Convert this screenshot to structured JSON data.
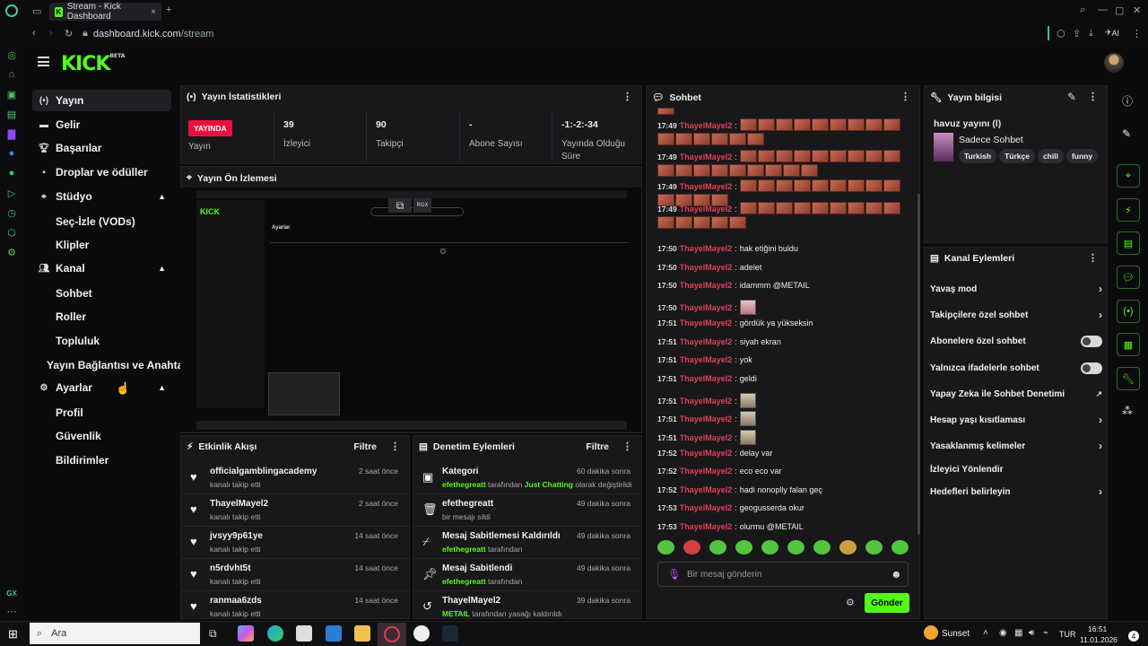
{
  "browser": {
    "tab_title": "Stream - Kick Dashboard",
    "url_host": "dashboard.kick.com",
    "url_path": "/stream",
    "ai_label": "AI"
  },
  "header": {
    "logo": "KICK",
    "beta": "BETA"
  },
  "nav": {
    "yayin": "Yayın",
    "gelir": "Gelir",
    "basarilar": "Başarılar",
    "droplar": "Droplar ve ödüller",
    "studyo": "Stüdyo",
    "sec_izle": "Seç-İzle (VODs)",
    "klipler": "Klipler",
    "kanal": "Kanal",
    "sohbet": "Sohbet",
    "roller": "Roller",
    "topluluk": "Topluluk",
    "yayin_baglantisi": "Yayın Bağlantısı ve Anahtarı",
    "ayarlar": "Ayarlar",
    "profil": "Profil",
    "guvenlik": "Güvenlik",
    "bildirimler": "Bildirimler"
  },
  "stats": {
    "title": "Yayın İstatistikleri",
    "live_badge": "YAYINDA",
    "live_label": "Yayın",
    "viewers": "39",
    "viewers_label": "İzleyici",
    "followers": "90",
    "followers_label": "Takipçi",
    "subs": "-",
    "subs_label": "Abone Sayısı",
    "duration": "-1:-2:-34",
    "duration_label": "Yayında Olduğu Süre"
  },
  "preview": {
    "title": "Yayın Ön İzlemesi",
    "rgx": "RGX",
    "mini_title": "Ayarlar"
  },
  "activity": {
    "title": "Etkinlik Akışı",
    "filter": "Filtre",
    "items": [
      {
        "name": "officialgamblingacademy",
        "sub": "kanalı takip etti",
        "time": "2 saat önce"
      },
      {
        "name": "ThayelMayel2",
        "sub": "kanalı takip etti",
        "time": "2 saat önce"
      },
      {
        "name": "jvsyy9p61ye",
        "sub": "kanalı takip etti",
        "time": "14 saat önce"
      },
      {
        "name": "n5rdvht5t",
        "sub": "kanalı takip etti",
        "time": "14 saat önce"
      },
      {
        "name": "ranmaa6zds",
        "sub": "kanalı takip etti",
        "time": "14 saat önce"
      }
    ]
  },
  "moderation": {
    "title": "Denetim Eylemleri",
    "filter": "Filtre",
    "items": [
      {
        "name": "Kategori",
        "who": "efethegreatt",
        "sub": " tarafından ",
        "extra": "Just Chatting",
        "tail": " olarak değiştirildi",
        "time": "60 dakika sonra"
      },
      {
        "name": "efethegreatt",
        "who": "",
        "sub": "bir mesajı sildi",
        "extra": "",
        "tail": "",
        "time": "49 dakika sonra"
      },
      {
        "name": "Mesaj Sabitlemesi Kaldırıldı",
        "who": "efethegreatt",
        "sub": " tarafından",
        "extra": "",
        "tail": "",
        "time": "49 dakika sonra"
      },
      {
        "name": "Mesaj Sabitlendi",
        "who": "efethegreatt",
        "sub": " tarafından",
        "extra": "",
        "tail": "",
        "time": "49 dakika sonra"
      },
      {
        "name": "ThayelMayel2",
        "who": "METAIL",
        "sub": " tarafından yasağı kaldırıldı",
        "extra": "",
        "tail": "",
        "time": "39 dakika sonra"
      }
    ]
  },
  "chat": {
    "title": "Sohbet",
    "user": "ThayelMayel2",
    "messages": [
      {
        "time": "17:49",
        "text": ""
      },
      {
        "time": "17:49",
        "text": ""
      },
      {
        "time": "17:49",
        "text": ""
      },
      {
        "time": "17:49",
        "text": ""
      },
      {
        "time": "17:50",
        "text": "hak etiğini buldu"
      },
      {
        "time": "17:50",
        "text": "adelet"
      },
      {
        "time": "17:50",
        "text": "idammm @METAIL"
      },
      {
        "time": "17:50",
        "text": ""
      },
      {
        "time": "17:51",
        "text": "gördük ya yükseksin"
      },
      {
        "time": "17:51",
        "text": "siyah ekran"
      },
      {
        "time": "17:51",
        "text": "yok"
      },
      {
        "time": "17:51",
        "text": "geldi"
      },
      {
        "time": "17:51",
        "text": ""
      },
      {
        "time": "17:51",
        "text": ""
      },
      {
        "time": "17:51",
        "text": ""
      },
      {
        "time": "17:52",
        "text": "delay var"
      },
      {
        "time": "17:52",
        "text": "eco eco var"
      },
      {
        "time": "17:52",
        "text": "hadi nonoplly falan geç"
      },
      {
        "time": "17:53",
        "text": "geogusserda okur"
      },
      {
        "time": "17:53",
        "text": "olurmu @METAIL"
      }
    ],
    "placeholder": "Bir mesaj gönderin",
    "send": "Gönder"
  },
  "stream_info": {
    "title": "Yayın bilgisi",
    "stream_title": "havuz yayını (l)",
    "category": "Sadece Sohbet",
    "tags": [
      "Turkish",
      "Türkçe",
      "chill",
      "funny"
    ]
  },
  "channel_actions": {
    "title": "Kanal Eylemleri",
    "slow": "Yavaş mod",
    "followers_only": "Takipçilere özel sohbet",
    "subs_only": "Abonelere özel sohbet",
    "emotes_only": "Yalnızca ifadelerle sohbet",
    "ai_mod": "Yapay Zeka ile Sohbet Denetimi",
    "age": "Hesap yaşı kısıtlaması",
    "banned_words": "Yasaklanmış kelimeler",
    "redirect": "İzleyici Yönlendir",
    "goals": "Hedefleri belirleyin"
  },
  "taskbar": {
    "search": "Ara",
    "weather": "Sunset",
    "lang": "TUR",
    "time": "16:51",
    "date": "11.01.2026",
    "notif": "4"
  },
  "colors": {
    "brand": "#53fc18",
    "live": "#e9113c",
    "username": "#e04157"
  }
}
